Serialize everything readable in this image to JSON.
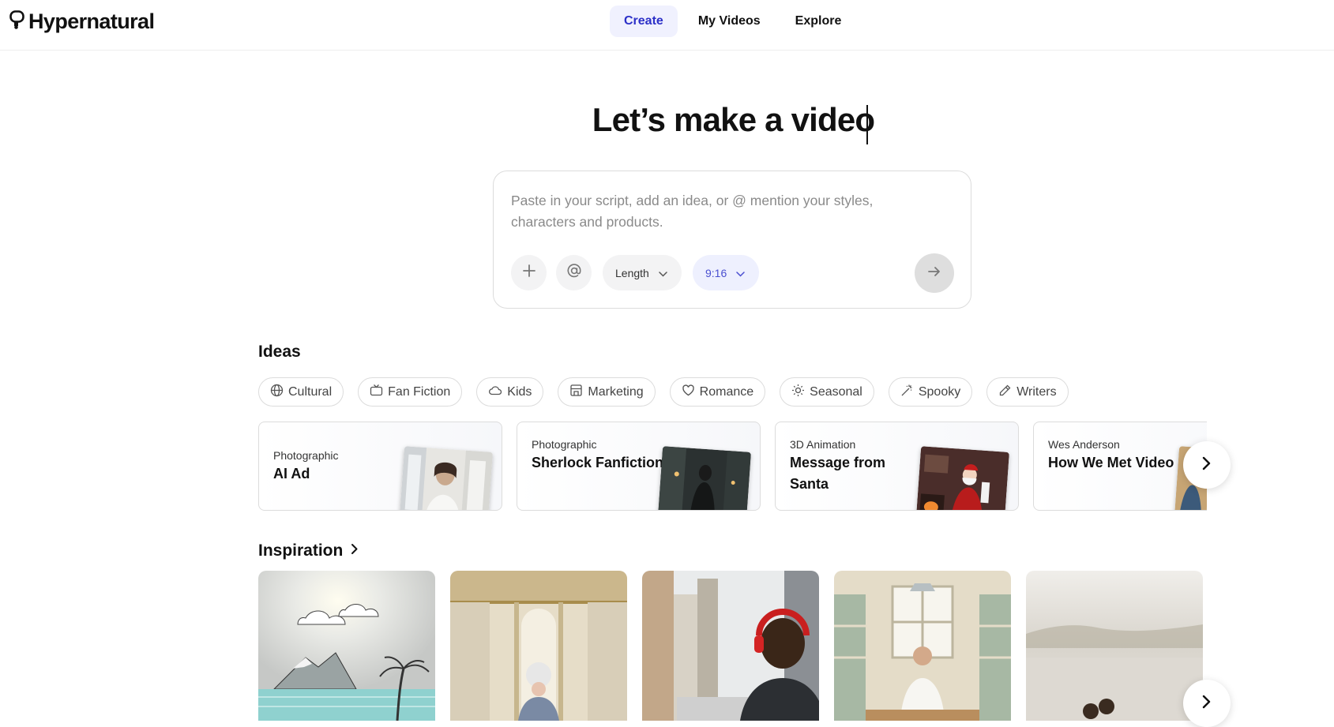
{
  "header": {
    "logo_text": "Hypernatural",
    "nav": [
      {
        "label": "Create",
        "active": true
      },
      {
        "label": "My Videos",
        "active": false
      },
      {
        "label": "Explore",
        "active": false
      }
    ]
  },
  "hero": {
    "title": "Let’s make a video",
    "prompt_placeholder": "Paste in your script, add an idea, or @ mention your styles, characters and products.",
    "length_label": "Length",
    "ratio_label": "9:16"
  },
  "ideas": {
    "title": "Ideas",
    "chips": [
      {
        "label": "Cultural",
        "icon": "globe-icon"
      },
      {
        "label": "Fan Fiction",
        "icon": "tv-icon"
      },
      {
        "label": "Kids",
        "icon": "cloud-icon"
      },
      {
        "label": "Marketing",
        "icon": "store-icon"
      },
      {
        "label": "Romance",
        "icon": "heart-icon"
      },
      {
        "label": "Seasonal",
        "icon": "sun-icon"
      },
      {
        "label": "Spooky",
        "icon": "magic-wand-icon"
      },
      {
        "label": "Writers",
        "icon": "pencil-icon"
      }
    ],
    "cards": [
      {
        "category": "Photographic",
        "title": "AI Ad"
      },
      {
        "category": "Photographic",
        "title": "Sherlock Fanfiction"
      },
      {
        "category": "3D Animation",
        "title": "Message from Santa"
      },
      {
        "category": "Wes Anderson",
        "title": "How We Met Video"
      }
    ]
  },
  "inspiration": {
    "title": "Inspiration",
    "items": [
      {
        "scene": "illustrated-island-sunrise"
      },
      {
        "scene": "baroque-palace-hallway"
      },
      {
        "scene": "city-street-headphones"
      },
      {
        "scene": "kitchen-chef"
      },
      {
        "scene": "misty-lake"
      }
    ]
  },
  "colors": {
    "accent": "#2c30c8",
    "active_nav_bg": "#f0f1fe",
    "placeholder": "#8a8a8a"
  }
}
